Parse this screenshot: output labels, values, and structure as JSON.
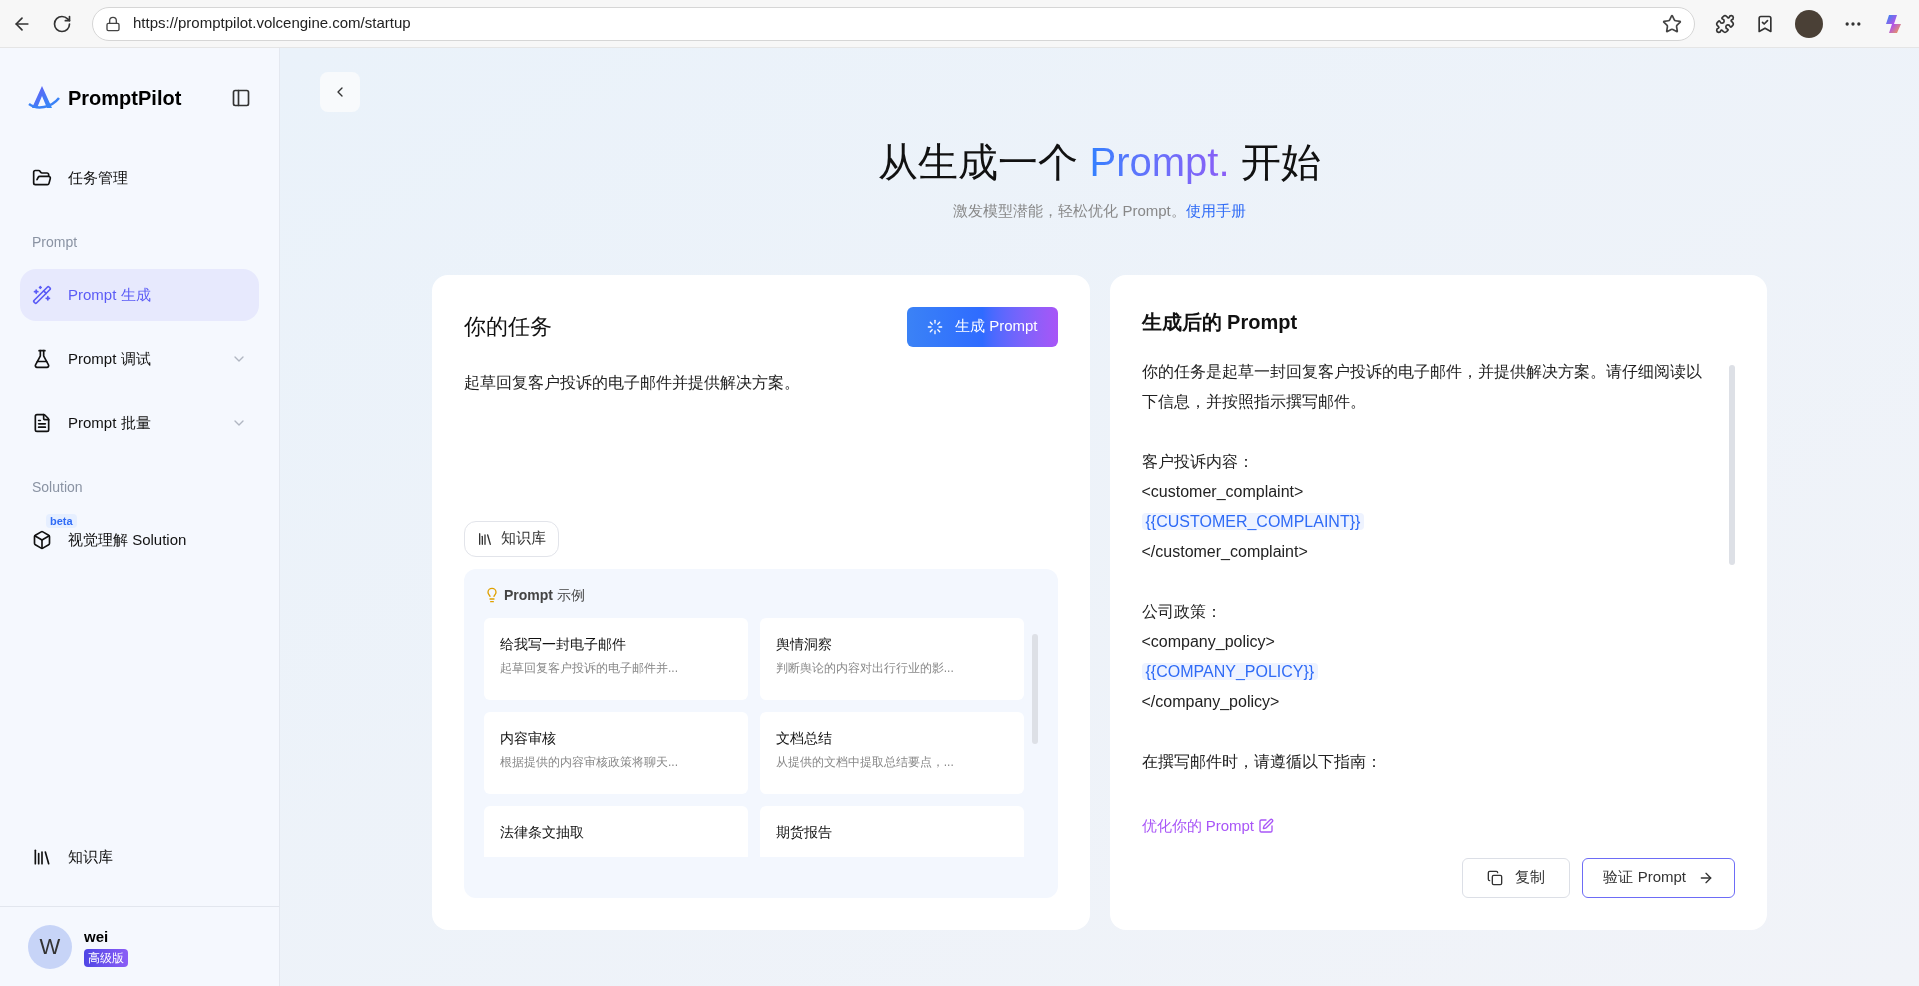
{
  "browser": {
    "url": "https://promptpilot.volcengine.com/startup"
  },
  "sidebar": {
    "brand": "PromptPilot",
    "items": [
      {
        "kind": "link",
        "label": "任务管理",
        "selected": false
      },
      {
        "kind": "section",
        "label": "Prompt"
      },
      {
        "kind": "link",
        "label": "Prompt 生成",
        "selected": true
      },
      {
        "kind": "group",
        "label": "Prompt 调试",
        "selected": false,
        "expanded": false
      },
      {
        "kind": "group",
        "label": "Prompt 批量",
        "selected": false,
        "expanded": false
      },
      {
        "kind": "section",
        "label": "Solution"
      },
      {
        "kind": "link",
        "label": "视觉理解 Solution",
        "selected": false,
        "badge": "beta"
      }
    ],
    "bottom_item": {
      "label": "知识库"
    },
    "user": {
      "initial": "W",
      "name": "wei",
      "plan": "高级版"
    }
  },
  "header": {
    "title_before": "从生成一个",
    "title_highlight": "Prompt.",
    "title_after": "开始",
    "subtitle": "激发模型潜能，轻松优化 Prompt。",
    "link": "使用手册"
  },
  "task_card": {
    "title": "你的任务",
    "generate_button": "生成 Prompt",
    "task_text": "起草回复客户投诉的电子邮件并提供解决方案。",
    "knowledge_button": "知识库",
    "examples_title": "Prompt 示例",
    "examples": [
      {
        "title": "给我写一封电子邮件",
        "description": "起草回复客户投诉的电子邮件并..."
      },
      {
        "title": "舆情洞察",
        "description": "判断舆论的内容对出行行业的影..."
      },
      {
        "title": "内容审核",
        "description": "根据提供的内容审核政策将聊天..."
      },
      {
        "title": "文档总结",
        "description": "从提供的文档中提取总结要点，..."
      },
      {
        "title": "法律条文抽取"
      },
      {
        "title": "期货报告"
      }
    ]
  },
  "result_card": {
    "title": "生成后的 Prompt",
    "lines": [
      {
        "kind": "text",
        "text": "你的任务是起草一封回复客户投诉的电子邮件，并提供解决方案。请仔细阅读以下信息，并按照指示撰写邮件。"
      },
      {
        "kind": "gap"
      },
      {
        "kind": "text",
        "text": "客户投诉内容："
      },
      {
        "kind": "text",
        "text": "<customer_complaint>"
      },
      {
        "kind": "variable",
        "text": "{{CUSTOMER_COMPLAINT}}"
      },
      {
        "kind": "text",
        "text": "</customer_complaint>"
      },
      {
        "kind": "gap"
      },
      {
        "kind": "text",
        "text": "公司政策："
      },
      {
        "kind": "text",
        "text": "<company_policy>"
      },
      {
        "kind": "variable",
        "text": "{{COMPANY_POLICY}}"
      },
      {
        "kind": "text",
        "text": "</company_policy>"
      },
      {
        "kind": "gap"
      },
      {
        "kind": "text",
        "text": "在撰写邮件时，请遵循以下指南："
      }
    ],
    "optimize_link": "优化你的 Prompt",
    "copy_button": "复制",
    "verify_button": "验证 Prompt"
  }
}
